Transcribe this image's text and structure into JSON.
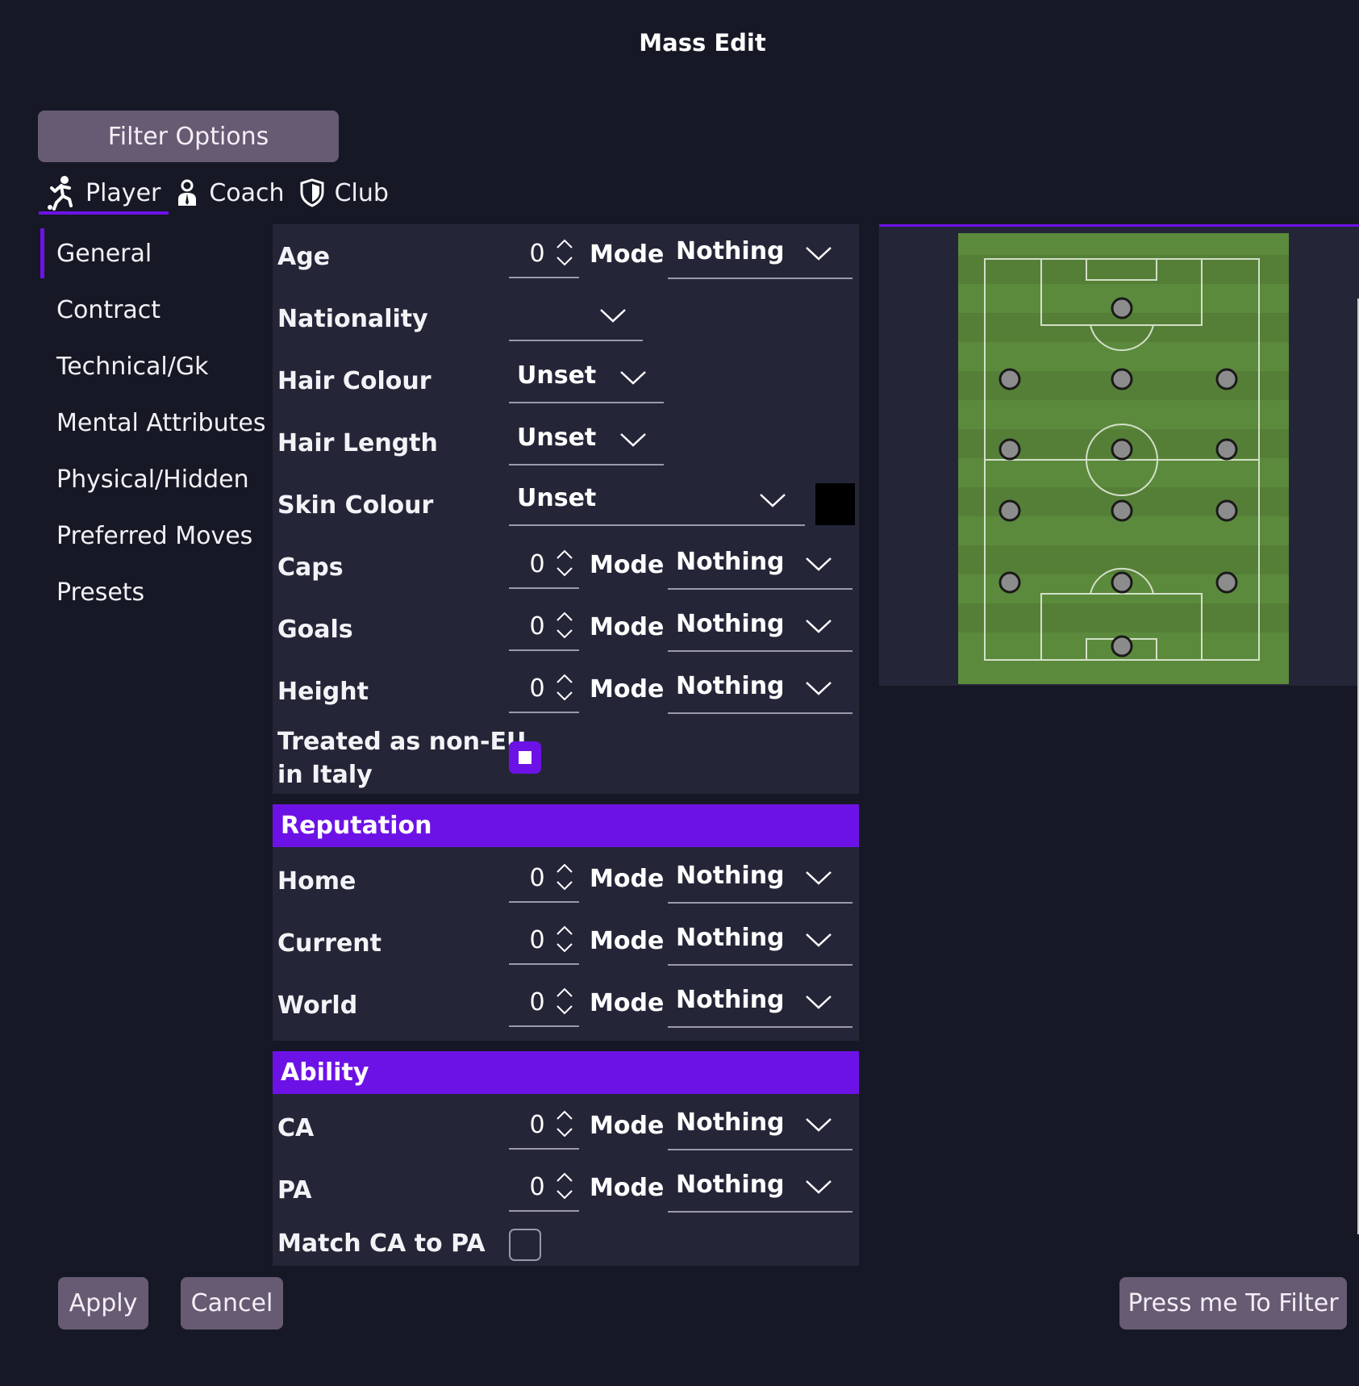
{
  "window": {
    "title": "Mass Edit"
  },
  "filter_options": {
    "label": "Filter Options"
  },
  "entity_tabs": [
    {
      "label": "Player",
      "icon": "player-kick-icon",
      "active": true
    },
    {
      "label": "Coach",
      "icon": "coach-icon",
      "active": false
    },
    {
      "label": "Club",
      "icon": "club-shield-icon",
      "active": false
    }
  ],
  "subnav": [
    {
      "label": "General",
      "active": true
    },
    {
      "label": "Contract"
    },
    {
      "label": "Technical/Gk"
    },
    {
      "label": "Mental Attributes"
    },
    {
      "label": "Physical/Hidden"
    },
    {
      "label": "Preferred Moves"
    },
    {
      "label": "Presets"
    }
  ],
  "general": {
    "age": {
      "label": "Age",
      "value": "0",
      "mode_label": "Mode",
      "mode": "Nothing"
    },
    "nationality": {
      "label": "Nationality",
      "value": ""
    },
    "hair_colour": {
      "label": "Hair Colour",
      "value": "Unset"
    },
    "hair_length": {
      "label": "Hair Length",
      "value": "Unset"
    },
    "skin_colour": {
      "label": "Skin Colour",
      "value": "Unset",
      "swatch_color": "#000000"
    },
    "caps": {
      "label": "Caps",
      "value": "0",
      "mode_label": "Mode",
      "mode": "Nothing"
    },
    "goals": {
      "label": "Goals",
      "value": "0",
      "mode_label": "Mode",
      "mode": "Nothing"
    },
    "height": {
      "label": "Height",
      "value": "0",
      "mode_label": "Mode",
      "mode": "Nothing"
    },
    "non_eu": {
      "label_line1": "Treated as non-EU",
      "label_line2": "in Italy",
      "checked": true
    }
  },
  "reputation": {
    "header": "Reputation",
    "home": {
      "label": "Home",
      "value": "0",
      "mode_label": "Mode",
      "mode": "Nothing"
    },
    "current": {
      "label": "Current",
      "value": "0",
      "mode_label": "Mode",
      "mode": "Nothing"
    },
    "world": {
      "label": "World",
      "value": "0",
      "mode_label": "Mode",
      "mode": "Nothing"
    }
  },
  "ability": {
    "header": "Ability",
    "ca": {
      "label": "CA",
      "value": "0",
      "mode_label": "Mode",
      "mode": "Nothing"
    },
    "pa": {
      "label": "PA",
      "value": "0",
      "mode_label": "Mode",
      "mode": "Nothing"
    },
    "match": {
      "label": "Match CA to PA",
      "checked": false
    }
  },
  "buttons": {
    "apply": "Apply",
    "cancel": "Cancel",
    "filter": "Press me To Filter"
  },
  "colors": {
    "accent": "#6d12e6",
    "background": "#171825",
    "panel": "#242638",
    "button": "#675a73",
    "pitch": "#5b8a3c"
  }
}
